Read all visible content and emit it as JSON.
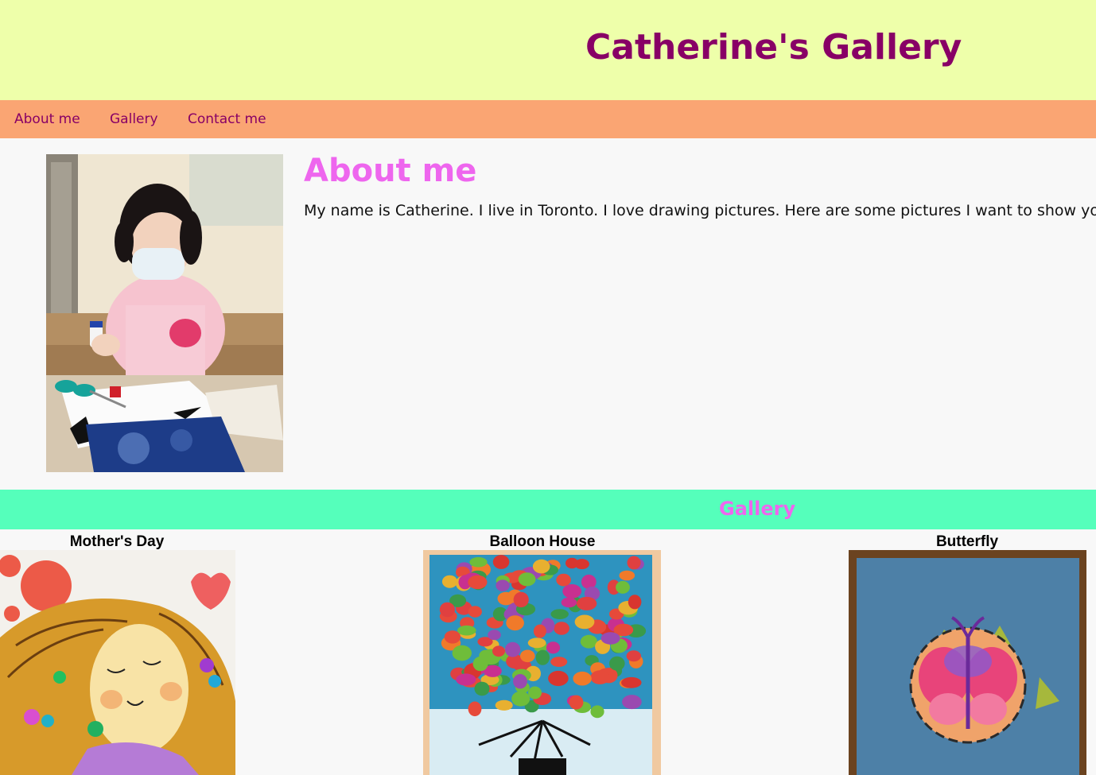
{
  "header": {
    "title": "Catherine's Gallery"
  },
  "nav": {
    "items": [
      "About me",
      "Gallery",
      "Contact me"
    ]
  },
  "about": {
    "heading": "About me",
    "text": "My name is Catherine. I live in Toronto. I love drawing pictures. Here are some pictures I want to show you"
  },
  "gallery": {
    "heading": "Gallery",
    "artworks": [
      {
        "title": "Mother's Day"
      },
      {
        "title": "Balloon House"
      },
      {
        "title": "Butterfly"
      }
    ]
  },
  "colors": {
    "header_bg": "#eeffaa",
    "title": "#880066",
    "nav_bg": "#faa573",
    "heading_pink": "#ee66ee",
    "gallery_band": "#55ffbb"
  }
}
